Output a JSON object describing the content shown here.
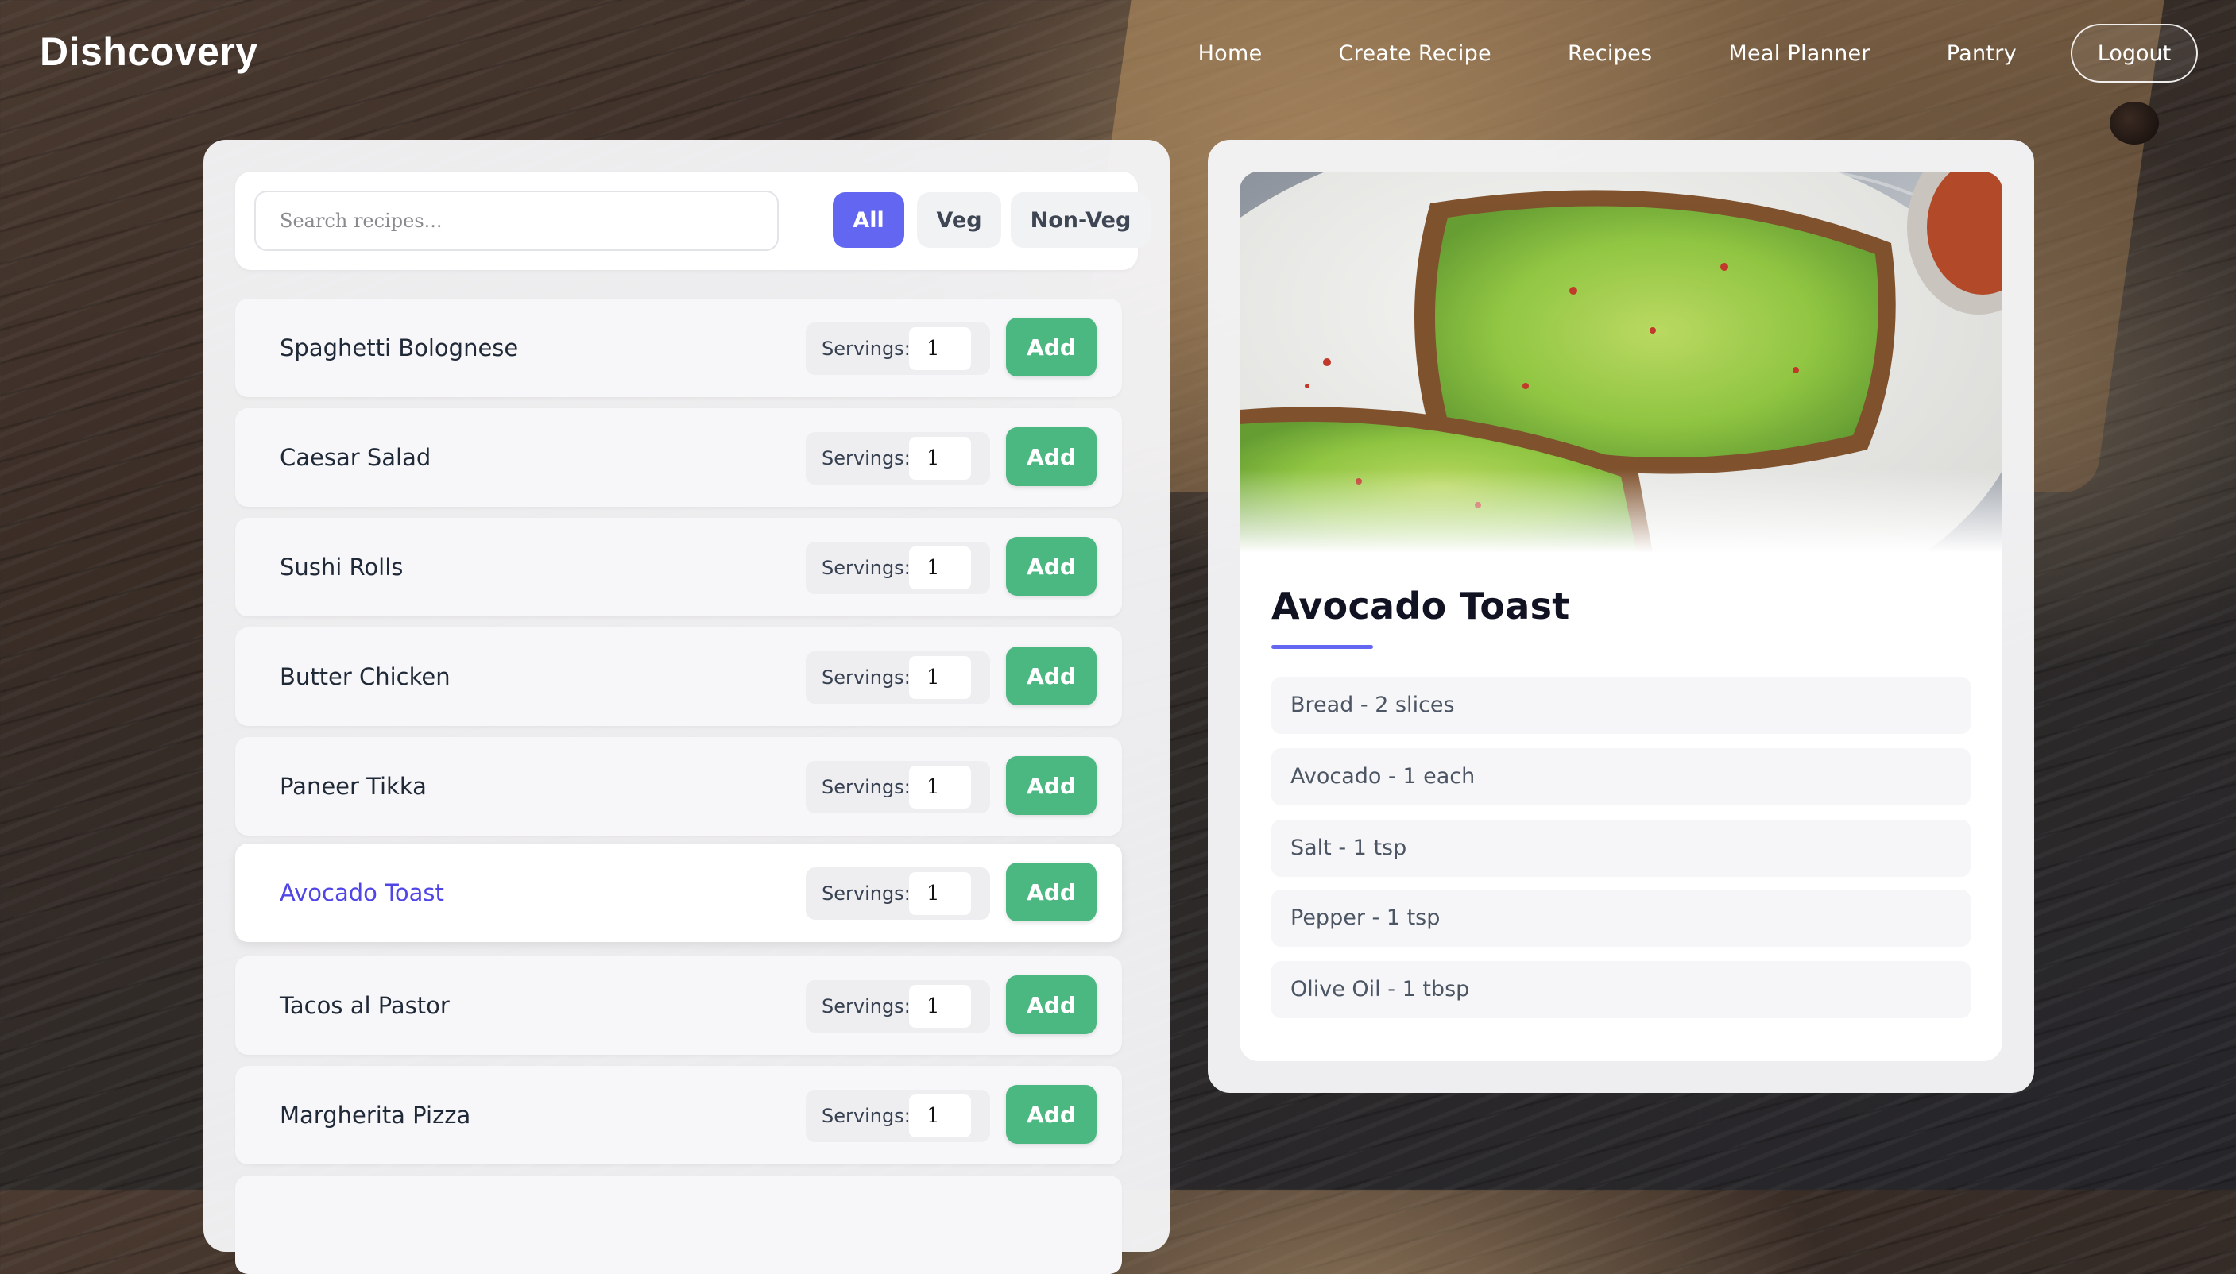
{
  "brand": "Dishcovery",
  "nav": {
    "items": [
      "Home",
      "Create Recipe",
      "Recipes",
      "Meal Planner",
      "Pantry"
    ],
    "logout_label": "Logout"
  },
  "search": {
    "placeholder": "Search recipes...",
    "value": ""
  },
  "filters": [
    {
      "label": "All",
      "active": true
    },
    {
      "label": "Veg",
      "active": false
    },
    {
      "label": "Non-Veg",
      "active": false
    }
  ],
  "recipes": [
    {
      "name": "Spaghetti Bolognese",
      "servings_label": "Servings:",
      "servings": "1",
      "add_label": "Add"
    },
    {
      "name": "Caesar Salad",
      "servings_label": "Servings:",
      "servings": "1",
      "add_label": "Add"
    },
    {
      "name": "Sushi Rolls",
      "servings_label": "Servings:",
      "servings": "1",
      "add_label": "Add"
    },
    {
      "name": "Butter Chicken",
      "servings_label": "Servings:",
      "servings": "1",
      "add_label": "Add"
    },
    {
      "name": "Paneer Tikka",
      "servings_label": "Servings:",
      "servings": "1",
      "add_label": "Add"
    },
    {
      "name": "Avocado Toast",
      "servings_label": "Servings:",
      "servings": "1",
      "add_label": "Add",
      "selected": true
    },
    {
      "name": "Tacos al Pastor",
      "servings_label": "Servings:",
      "servings": "1",
      "add_label": "Add"
    },
    {
      "name": "Margherita Pizza",
      "servings_label": "Servings:",
      "servings": "1",
      "add_label": "Add"
    }
  ],
  "detail": {
    "title": "Avocado Toast",
    "ingredients": [
      "Bread - 2 slices",
      "Avocado - 1 each",
      "Salt - 1 tsp",
      "Pepper - 1 tsp",
      "Olive Oil - 1 tbsp"
    ]
  },
  "colors": {
    "accent": "#6366f1",
    "add_button": "#4bb882",
    "selected_text": "#4f46e5"
  }
}
